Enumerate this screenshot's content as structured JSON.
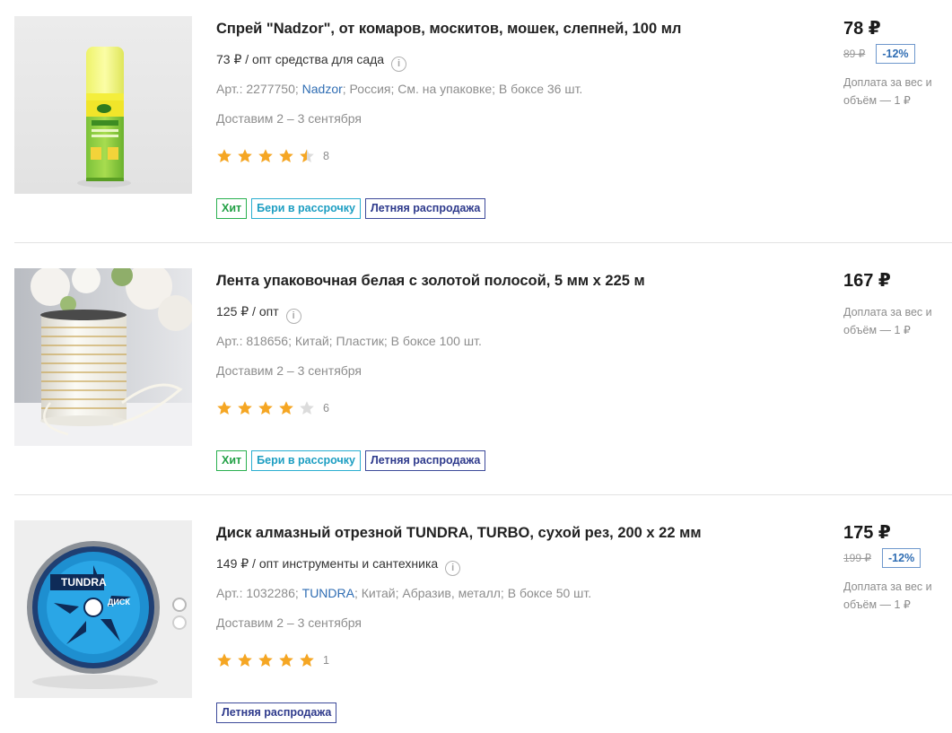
{
  "colors": {
    "star_filled": "#f5a623",
    "star_empty": "#dcdcdc",
    "link": "#2f6db3",
    "badge_hit": "#22a045",
    "badge_installment": "#1d9ec2",
    "badge_sale": "#2e3a8c"
  },
  "products": [
    {
      "title": "Спрей \"Nadzor\", от комаров, москитов, мошек, слепней, 100 мл",
      "wholesale": "73 ₽ / опт средства для сада",
      "specs": {
        "article": "Арт.: 2277750;",
        "brand": "Nadzor",
        "rest": "; Россия; См. на упаковке; В боксе 36 шт."
      },
      "delivery": "Доставим 2 – 3 сентября",
      "rating": 4.5,
      "reviews": "8",
      "badges": [
        "Хит",
        "Бери в рассрочку",
        "Летняя распродажа"
      ],
      "price": "78 ₽",
      "old_price": "89 ₽",
      "discount": "-12%",
      "surcharge": "Доплата за вес и объём — 1 ₽",
      "image_icon": "spray-bottle-image"
    },
    {
      "title": "Лента упаковочная белая с золотой полосой, 5 мм х 225 м",
      "wholesale": "125 ₽ / опт",
      "specs": {
        "article": "Арт.: 818656; Китай; Пластик; В боксе 100 шт.",
        "brand": "",
        "rest": ""
      },
      "delivery": "Доставим 2 – 3 сентября",
      "rating": 4,
      "reviews": "6",
      "badges": [
        "Хит",
        "Бери в рассрочку",
        "Летняя распродажа"
      ],
      "price": "167 ₽",
      "old_price": "",
      "discount": "",
      "surcharge": "Доплата за вес и объём — 1 ₽",
      "image_icon": "ribbon-spool-image"
    },
    {
      "title": "Диск алмазный отрезной TUNDRA, TURBO, сухой рез, 200 х 22 мм",
      "wholesale": "149 ₽ / опт инструменты и сантехника",
      "specs": {
        "article": "Арт.: 1032286;",
        "brand": "TUNDRA",
        "rest": "; Китай; Абразив, металл; В боксе 50 шт."
      },
      "delivery": "Доставим 2 – 3 сентября",
      "rating": 5,
      "reviews": "1",
      "badges": [
        "Летняя распродажа"
      ],
      "price": "175 ₽",
      "old_price": "199 ₽",
      "discount": "-12%",
      "surcharge": "Доплата за вес и объём — 1 ₽",
      "image_icon": "diamond-disc-image",
      "disc_label_brand": "TUNDRA",
      "disc_label_title": "ДИСК"
    }
  ]
}
